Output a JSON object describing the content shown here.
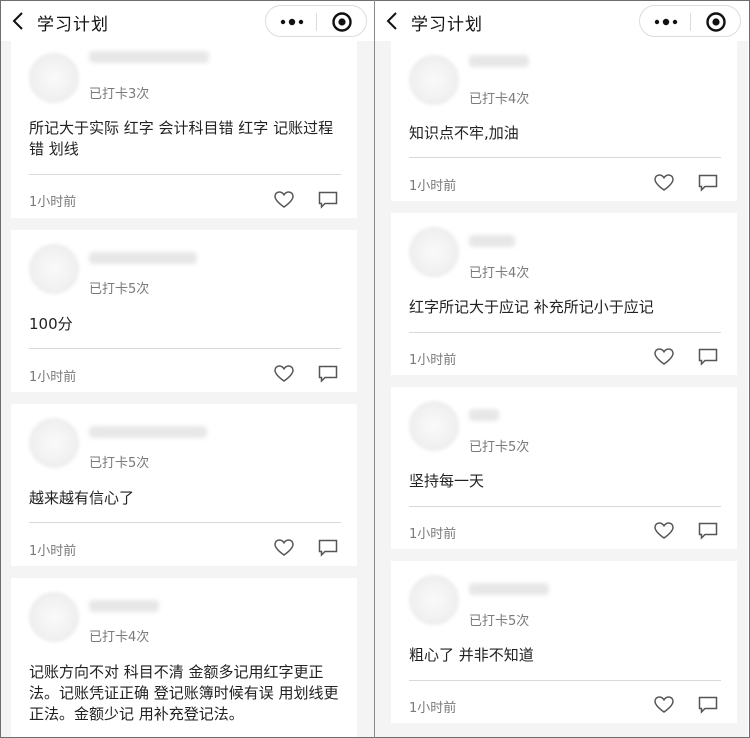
{
  "left_pane": {
    "title": "学习计划",
    "posts": [
      {
        "checkins": "已打卡3次",
        "content": "所记大于实际 红字 会计科目错 红字 记账过程错 划线",
        "time": "1小时前"
      },
      {
        "checkins": "已打卡5次",
        "content": "100分",
        "time": "1小时前"
      },
      {
        "checkins": "已打卡5次",
        "content": "越来越有信心了",
        "time": "1小时前"
      },
      {
        "checkins": "已打卡4次",
        "content": "记账方向不对 科目不清 金额多记用红字更正法。记账凭证正确 登记账簿时候有误 用划线更正法。金额少记 用补充登记法。",
        "time": ""
      }
    ]
  },
  "right_pane": {
    "title": "学习计划",
    "posts": [
      {
        "checkins": "已打卡4次",
        "content": "知识点不牢,加油",
        "time": "1小时前"
      },
      {
        "checkins": "已打卡4次",
        "content": "红字所记大于应记 补充所记小于应记",
        "time": "1小时前"
      },
      {
        "checkins": "已打卡5次",
        "content": "坚持每一天",
        "time": "1小时前"
      },
      {
        "checkins": "已打卡5次",
        "content": "粗心了 并非不知道",
        "time": "1小时前"
      }
    ]
  },
  "icons": {
    "back": "chevron-left-icon",
    "more": "more-dots-icon",
    "close": "target-circle-icon",
    "like": "heart-icon",
    "comment": "comment-icon"
  },
  "colors": {
    "background": "#f4f4f4",
    "card": "#ffffff",
    "text": "#222222",
    "muted": "#7a7a7a"
  }
}
